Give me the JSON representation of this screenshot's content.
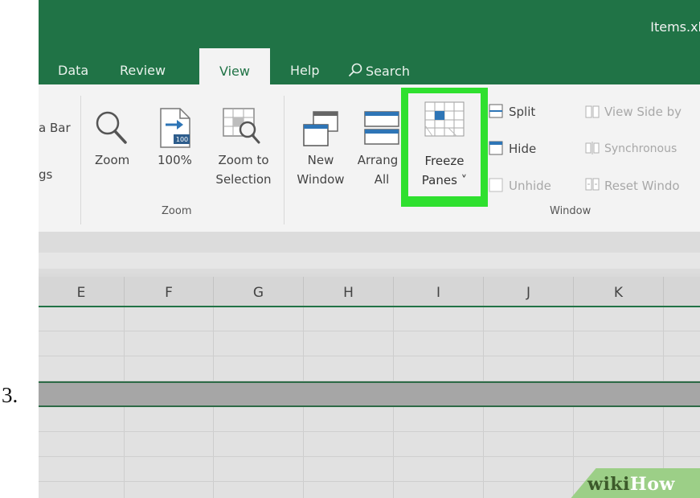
{
  "step": {
    "number": "3."
  },
  "title": {
    "file": "Items.xl"
  },
  "tabs": [
    {
      "label": "Data"
    },
    {
      "label": "Review"
    },
    {
      "label": "View"
    },
    {
      "label": "Help"
    },
    {
      "label": "Search"
    }
  ],
  "ribbon": {
    "cut_labels": [
      "a Bar",
      "gs"
    ],
    "zoom": {
      "label": "Zoom"
    },
    "hundred": {
      "label": "100%",
      "badge": "100"
    },
    "zoom_to_selection": {
      "line1": "Zoom to",
      "line2": "Selection"
    },
    "new_window": {
      "line1": "New",
      "line2": "Window"
    },
    "arrange_all": {
      "line1": "Arrang",
      "line2": "All"
    },
    "freeze_panes": {
      "line1": "Freeze",
      "line2": "Panes ˅"
    },
    "split": {
      "label": "Split"
    },
    "hide": {
      "label": "Hide"
    },
    "unhide": {
      "label": "Unhide"
    },
    "view_side_by_side": {
      "label": "View Side by"
    },
    "synchronous": {
      "label": "Synchronous"
    },
    "reset_window": {
      "label": "Reset Windo"
    },
    "groups": {
      "zoom": "Zoom",
      "window": "Window"
    }
  },
  "columns": [
    "E",
    "F",
    "G",
    "H",
    "I",
    "J",
    "K"
  ],
  "watermark": {
    "part1": "wiki",
    "part2": "How"
  },
  "colors": {
    "excel_green": "#207346",
    "highlight": "#2FE02F"
  }
}
